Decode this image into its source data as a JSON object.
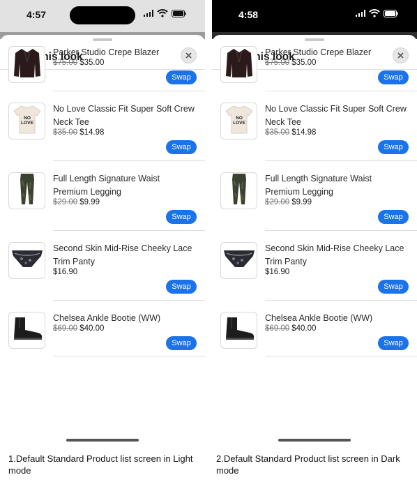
{
  "sheet": {
    "title": "Shop this look"
  },
  "swap_label": "Swap",
  "panels": [
    {
      "time": "4:57",
      "caption": "1.Default Standard Product list screen in Light mode"
    },
    {
      "time": "4:58",
      "caption": "2.Default Standard Product list screen in Dark mode"
    }
  ],
  "products": [
    {
      "name": "Parker Studio Crepe Blazer",
      "old_price": "$75.00",
      "price": "$35.00",
      "icon": "blazer-icon"
    },
    {
      "name": "No Love Classic Fit Super Soft Crew Neck Tee",
      "old_price": "$35.00",
      "price": "$14.98",
      "icon": "tee-icon"
    },
    {
      "name": "Full Length Signature Waist Premium Legging",
      "old_price": "$29.00",
      "price": "$9.99",
      "icon": "legging-icon"
    },
    {
      "name": "Second Skin Mid-Rise Cheeky Lace Trim Panty",
      "old_price": "",
      "price": "$16.90",
      "icon": "panty-icon"
    },
    {
      "name": "Chelsea Ankle Bootie (WW)",
      "old_price": "$69.00",
      "price": "$40.00",
      "icon": "bootie-icon"
    }
  ],
  "colors": {
    "swap": "#1a73e8",
    "dark_status": "#000000",
    "light_status": "#e2e2e2"
  }
}
